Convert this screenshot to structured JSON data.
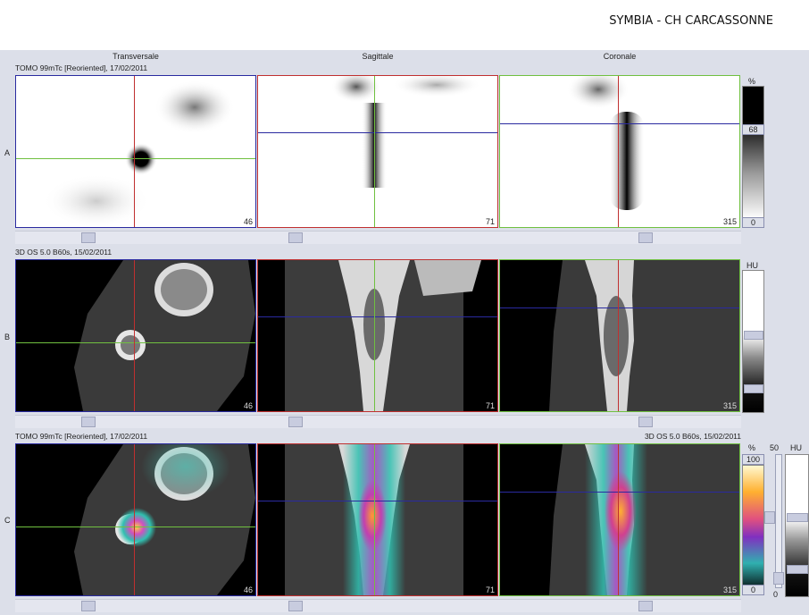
{
  "header": {
    "institution": "SYMBIA - CH CARCASSONNE"
  },
  "columns": [
    "Transversale",
    "Sagittale",
    "Coronale"
  ],
  "rows": [
    {
      "label": "A",
      "caption": "TOMO 99mTc [Reoriented], 17/02/2011",
      "caption_right": "",
      "slices": [
        "46",
        "71",
        "315"
      ]
    },
    {
      "label": "B",
      "caption": "3D  OS  5.0  B60s, 15/02/2011",
      "caption_right": "",
      "slices": [
        "46",
        "71",
        "315"
      ]
    },
    {
      "label": "C",
      "caption": "TOMO 99mTc [Reoriented], 17/02/2011",
      "caption_right": "3D  OS  5.0  B60s, 15/02/2011",
      "slices": [
        "46",
        "71",
        "315"
      ]
    }
  ],
  "colorbar_a": {
    "unit": "%",
    "level": "68",
    "min": "0"
  },
  "colorbar_b": {
    "unit": "HU"
  },
  "colorbar_c": {
    "unit": "%",
    "max": "100",
    "min": "0",
    "mid": "50",
    "unit2": "HU",
    "bottom": "0"
  },
  "colors": {
    "transverse_frame": "#2a2aa0",
    "sagittal_frame": "#c03030",
    "coronal_frame": "#70c040"
  }
}
